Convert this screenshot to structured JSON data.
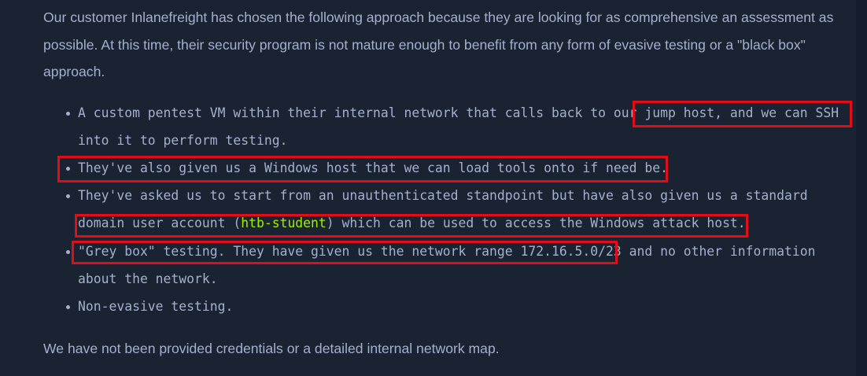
{
  "intro": {
    "line1": "Our customer Inlanefreight has chosen the following approach because they are looking for as comprehensive an assessment as",
    "line2": "possible. At this time, their security program is not mature enough to benefit from any form of evasive testing or a \"black box\"",
    "line3": "approach."
  },
  "bullets": {
    "b1_line1": "A custom pentest VM within their internal network that calls back to our jump host, and we can SSH",
    "b1_line2": "into it to perform testing.",
    "b2_line1": "They've also given us a Windows host that we can load tools onto if need be.",
    "b3_line1": "They've asked us to start from an unauthenticated standpoint but have also given us a standard",
    "b3_line2_pre": "domain user account (",
    "b3_line2_code": "htb-student",
    "b3_line2_post": ") which can be used to access the Windows attack host.",
    "b4_line1": "\"Grey box\" testing. They have given us the network range 172.16.5.0/23 and no other information",
    "b4_line2": "about the network.",
    "b5_line1": "Non-evasive testing."
  },
  "outro": {
    "line1": "We have not been provided credentials or a detailed internal network map."
  },
  "colors": {
    "background": "#1a2332",
    "text": "#a4b1cd",
    "code_accent": "#9fef00",
    "highlight_box": "#e10d18"
  }
}
